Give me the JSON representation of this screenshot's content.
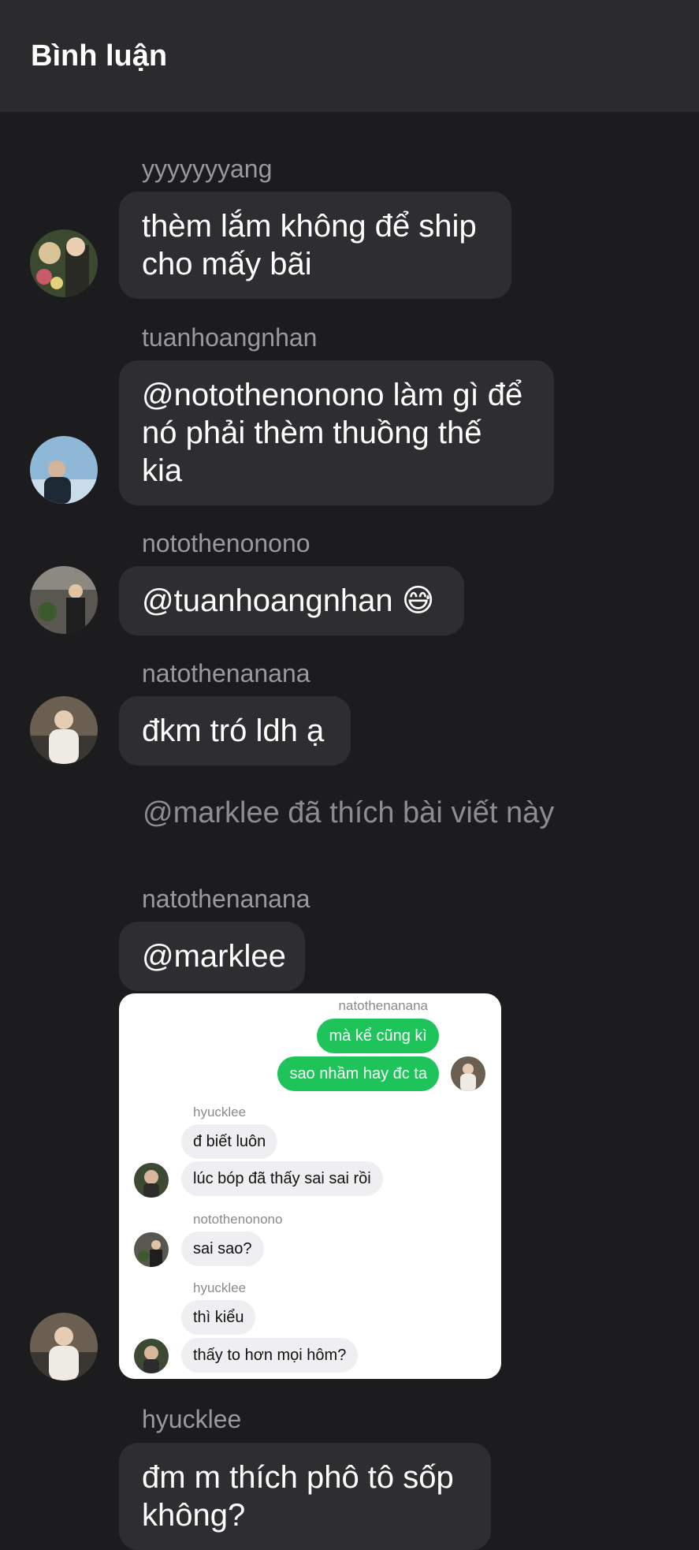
{
  "header": {
    "title": "Bình luận"
  },
  "comments": [
    {
      "username": "yyyyyyyang",
      "text": "thèm lắm không để ship cho mấy bãi",
      "avatar": "photo-avatar-flowers"
    },
    {
      "username": "tuanhoangnhan",
      "text": "@notothenonono làm gì để nó phải thèm thuồng thế kia",
      "avatar": "photo-avatar-sky"
    },
    {
      "username": "notothenonono",
      "text": "@tuanhoangnhan 😅",
      "avatar": "photo-avatar-street"
    },
    {
      "username": "natothenanana",
      "text": "đkm tró ldh ạ",
      "avatar": "photo-avatar-white-jacket"
    },
    {
      "username": "natothenanana",
      "text": "@marklee",
      "avatar": "photo-avatar-white-jacket"
    },
    {
      "username": "hyucklee",
      "text": "đm m thích phô tô sốp không?"
    }
  ],
  "like_notice": "@marklee đã thích bài viết này",
  "screenshot": {
    "sender": "natothenanana",
    "sent": [
      "mà kể cũng kì",
      "sao nhầm hay đc ta"
    ],
    "groups": [
      {
        "name": "hyucklee",
        "messages": [
          "đ biết luôn",
          "lúc bóp đã thấy sai sai rồi"
        ]
      },
      {
        "name": "notothenonono",
        "messages": [
          "sai sao?"
        ]
      },
      {
        "name": "hyucklee",
        "messages": [
          "thì kiểu",
          "thấy to hơn mọi hôm?"
        ]
      }
    ]
  },
  "colors": {
    "background": "#1c1c1e",
    "header": "#2b2b2d",
    "bubble": "#2e2e31",
    "sent_bubble": "#1ec35a"
  }
}
